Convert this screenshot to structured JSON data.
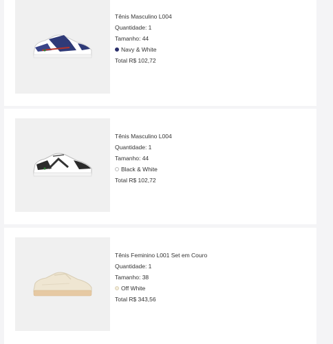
{
  "cart": {
    "items": [
      {
        "name": "Tênis Masculino L004",
        "quantity": "Quantidade: 1",
        "size": "Tamanho: 44",
        "color_name": "Navy & White",
        "color_swatch": "#2a2f6b",
        "total": "Total R$ 102,72",
        "image_icon": "sneaker-navy-white-icon"
      },
      {
        "name": "Tênis Masculino L004",
        "quantity": "Quantidade: 1",
        "size": "Tamanho: 44",
        "color_name": "Black & White",
        "color_swatch": "#ffffff",
        "total": "Total R$ 102,72",
        "image_icon": "sneaker-black-white-icon"
      },
      {
        "name": "Tênis Feminino L001 Set em Couro",
        "quantity": "Quantidade: 1",
        "size": "Tamanho: 38",
        "color_name": "Off White",
        "color_swatch": "#f3ecd9",
        "total": "Total R$ 343,56",
        "image_icon": "sneaker-off-white-icon"
      }
    ]
  }
}
